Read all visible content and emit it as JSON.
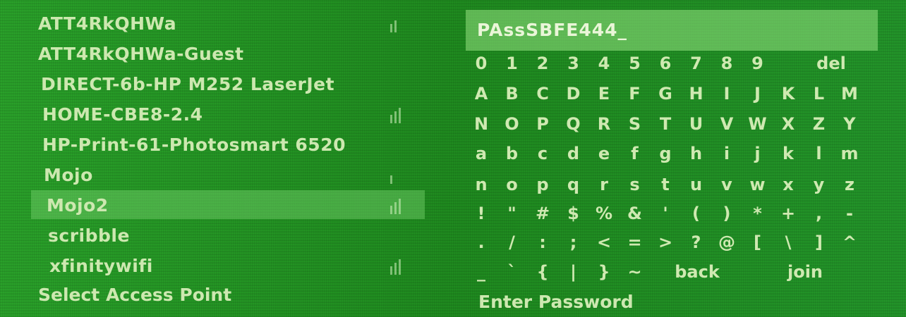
{
  "access_points": {
    "items": [
      {
        "name": "ATT4RkQHWa"
      },
      {
        "name": "ATT4RkQHWa-Guest"
      },
      {
        "name": "DIRECT-6b-HP M252 LaserJet"
      },
      {
        "name": "HOME-CBE8-2.4"
      },
      {
        "name": "HP-Print-61-Photosmart 6520"
      },
      {
        "name": "Mojo"
      },
      {
        "name": "Mojo2"
      },
      {
        "name": "scribble"
      },
      {
        "name": "xfinitywifi"
      }
    ],
    "selected_name": "Mojo2",
    "title": "Select Access Point"
  },
  "password": {
    "value": "PAssSBFE444_",
    "title": "Enter Password"
  },
  "keyboard": {
    "rows": [
      [
        "0",
        "1",
        "2",
        "3",
        "4",
        "5",
        "6",
        "7",
        "8",
        "9",
        "del"
      ],
      [
        "A",
        "B",
        "C",
        "D",
        "E",
        "F",
        "G",
        "H",
        "I",
        "J",
        "K",
        "L",
        "M"
      ],
      [
        "N",
        "O",
        "P",
        "Q",
        "R",
        "S",
        "T",
        "U",
        "V",
        "W",
        "X",
        "Z",
        "Y"
      ],
      [
        "a",
        "b",
        "c",
        "d",
        "e",
        "f",
        "g",
        "h",
        "i",
        "j",
        "k",
        "l",
        "m"
      ],
      [
        "n",
        "o",
        "p",
        "q",
        "r",
        "s",
        "t",
        "u",
        "v",
        "w",
        "x",
        "y",
        "z"
      ],
      [
        "!",
        "\"",
        "#",
        "$",
        "%",
        "&",
        "'",
        "(",
        ")",
        "*",
        "+",
        ",",
        "-"
      ],
      [
        ".",
        "/",
        ":",
        ";",
        "<",
        "=",
        ">",
        "?",
        "@",
        "[",
        "\\",
        "]",
        "^"
      ],
      [
        "_",
        "`",
        "{",
        "|",
        "}",
        "~",
        "back",
        "join"
      ]
    ]
  },
  "colors": {
    "background": "#1f8e1f",
    "text": "#cfe9b1",
    "highlight": "#78d26e"
  }
}
